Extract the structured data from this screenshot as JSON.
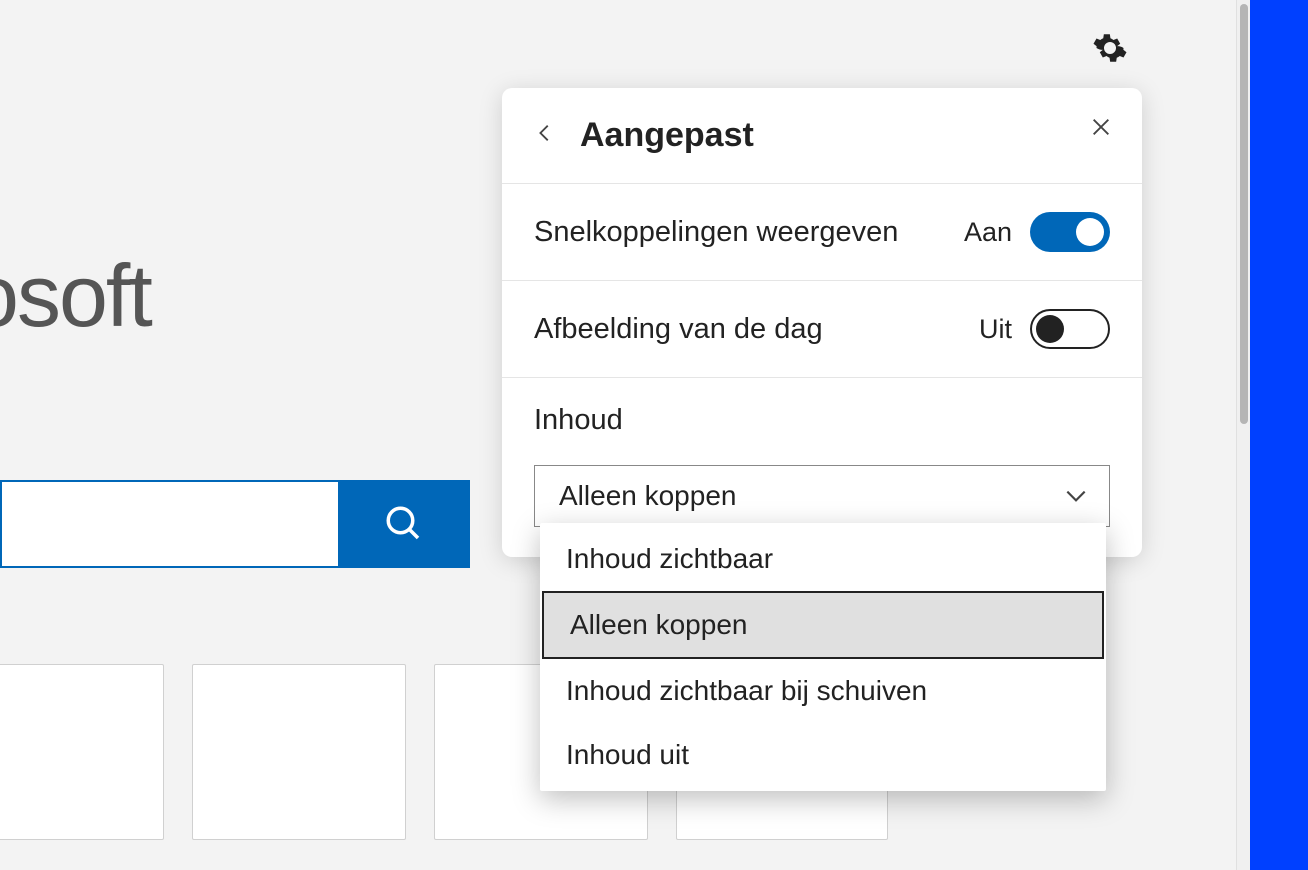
{
  "page": {
    "logo_fragment": "osoft"
  },
  "gear": {
    "name": "settings"
  },
  "panel": {
    "title": "Aangepast",
    "rows": [
      {
        "label": "Snelkoppelingen weergeven",
        "state_label": "Aan",
        "on": true
      },
      {
        "label": "Afbeelding van de dag",
        "state_label": "Uit",
        "on": false
      }
    ],
    "content": {
      "label": "Inhoud",
      "selected": "Alleen koppen",
      "options": [
        "Inhoud zichtbaar",
        "Alleen koppen",
        "Inhoud zichtbaar bij schuiven",
        "Inhoud uit"
      ],
      "selected_index": 1
    }
  }
}
